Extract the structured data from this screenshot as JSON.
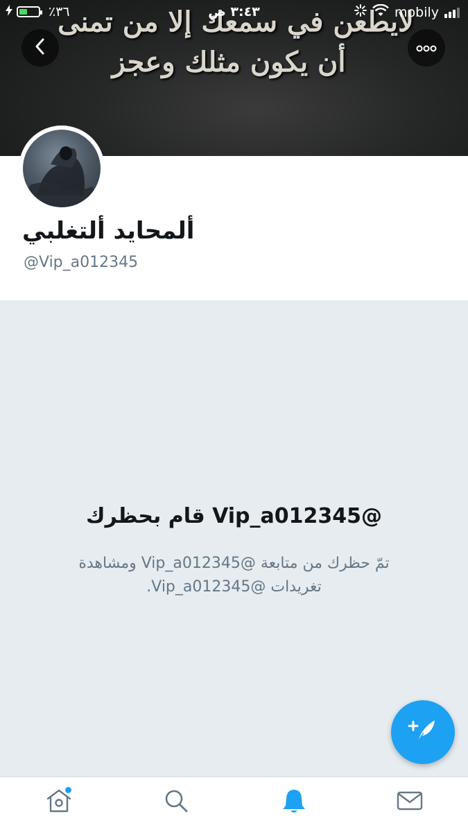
{
  "status_bar": {
    "battery_percent": "٪٣٦",
    "battery_level": 0.36,
    "time": "٣:٤٣ ص",
    "carrier": "mobily",
    "signal_bars": 3
  },
  "banner": {
    "line1": "لايطعن في سمعك إلا من تمنى",
    "line2": "أن يكون مثلك وعجز"
  },
  "profile": {
    "display_name": "ألمحايد ألتغلبي",
    "handle": "@Vip_a012345"
  },
  "blocked": {
    "title": "@Vip_a012345 قام بحظرك",
    "description": "تمّ حظرك من متابعة @Vip_a012345 ومشاهدة تغريدات @Vip_a012345."
  },
  "icons": {
    "back": "chevron-left-icon",
    "more": "more-dots-icon",
    "compose": "compose-tweet-icon",
    "home": "home-icon",
    "search": "search-icon",
    "notifications": "bell-icon",
    "messages": "mail-icon"
  },
  "colors": {
    "accent": "#1da1f2",
    "background": "#e6ecf0",
    "secondary_text": "#657786",
    "battery_fill": "#4cd964"
  },
  "tabs": {
    "active": "notifications",
    "home_has_unread": true
  }
}
